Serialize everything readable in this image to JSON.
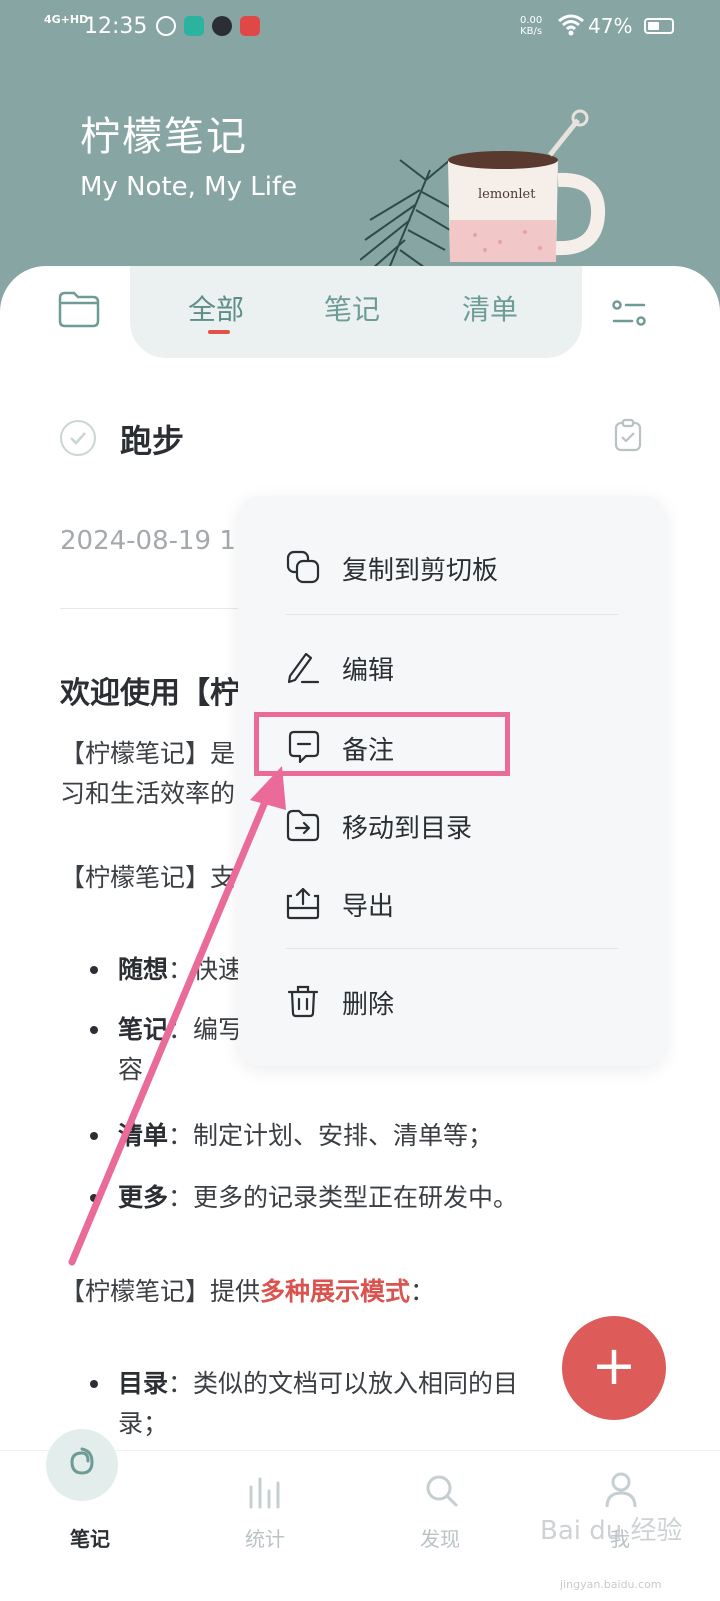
{
  "status_bar": {
    "signal": "4G+HD",
    "time": "12:35",
    "app_badges": [
      "",
      "",
      ""
    ],
    "net_speed_value": "0.00",
    "net_speed_unit": "KB/s",
    "battery_percent": "47%"
  },
  "header": {
    "title": "柠檬笔记",
    "subtitle": "My Note, My Life",
    "mug_text": "lemonlet"
  },
  "tabs": {
    "items": [
      {
        "label": "全部"
      },
      {
        "label": "笔记"
      },
      {
        "label": "清单"
      }
    ],
    "active_index": 0
  },
  "note": {
    "title": "跑步",
    "date": "2024-08-19 1",
    "heading": "欢迎使用【柠",
    "para1_line1": "【柠檬笔记】是",
    "para1_line2": "习和生活效率的",
    "para2": "【柠檬笔记】支",
    "bullets": [
      {
        "term": "随想",
        "text": "：快速"
      },
      {
        "term": "笔记",
        "text": "：编写",
        "text2": "容"
      },
      {
        "term": "清单",
        "text": "：制定计划、安排、清单等；"
      },
      {
        "term": "更多",
        "text": "：更多的记录类型正在研发中。"
      }
    ],
    "para3_prefix": "【柠檬笔记】提供",
    "para3_highlight": "多种展示模式",
    "para3_suffix": "：",
    "bullet_dir_term": "目录",
    "bullet_dir_text": "：类似的文档可以放入相同的目",
    "bullet_dir_text2": "录；"
  },
  "context_menu": {
    "items": [
      {
        "label": "复制到剪切板",
        "icon": "copy-icon"
      },
      {
        "label": "编辑",
        "icon": "pen-icon"
      },
      {
        "label": "备注",
        "icon": "comment-icon"
      },
      {
        "label": "移动到目录",
        "icon": "folder-move-icon"
      },
      {
        "label": "导出",
        "icon": "export-icon"
      },
      {
        "label": "删除",
        "icon": "trash-icon"
      }
    ],
    "highlighted_index": 2
  },
  "fab": {
    "label": "+"
  },
  "bottom_nav": {
    "items": [
      {
        "label": "笔记"
      },
      {
        "label": "统计"
      },
      {
        "label": "发现"
      },
      {
        "label": "我"
      }
    ],
    "active_index": 0
  },
  "watermark": {
    "text": "Bai du 经验",
    "sub": "jingyan.baidu.com"
  },
  "colors": {
    "header_bg": "#87a6a3",
    "accent_red": "#dd5c5a",
    "tab_text": "#6f9b97",
    "highlight_pink": "#ea6a98"
  }
}
